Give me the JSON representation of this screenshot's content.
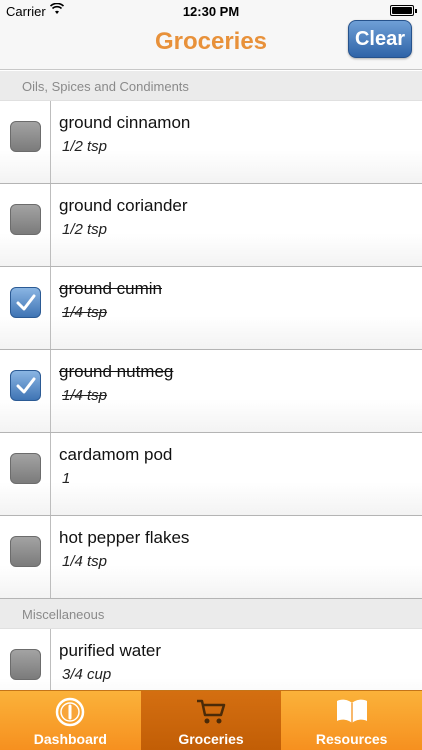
{
  "status_bar": {
    "carrier": "Carrier",
    "time": "12:30 PM"
  },
  "nav": {
    "title": "Groceries",
    "clear_label": "Clear",
    "title_color": "#e8913a",
    "button_color": "#3f74b4"
  },
  "sections": [
    {
      "title": "Oils, Spices and Condiments",
      "items": [
        {
          "name": "ground cinnamon",
          "qty": "1/2 tsp",
          "checked": false
        },
        {
          "name": "ground coriander",
          "qty": "1/2 tsp",
          "checked": false
        },
        {
          "name": "ground cumin",
          "qty": "1/4 tsp",
          "checked": true
        },
        {
          "name": "ground nutmeg",
          "qty": "1/4 tsp",
          "checked": true
        },
        {
          "name": "cardamom pod",
          "qty": "1",
          "checked": false
        },
        {
          "name": "hot pepper flakes",
          "qty": "1/4 tsp",
          "checked": false
        }
      ]
    },
    {
      "title": "Miscellaneous",
      "items": [
        {
          "name": "purified water",
          "qty": "3/4 cup",
          "checked": false
        }
      ]
    }
  ],
  "tabs": [
    {
      "label": "Dashboard",
      "icon": "dashboard-icon",
      "active": false
    },
    {
      "label": "Groceries",
      "icon": "cart-icon",
      "active": true
    },
    {
      "label": "Resources",
      "icon": "book-icon",
      "active": false
    }
  ]
}
